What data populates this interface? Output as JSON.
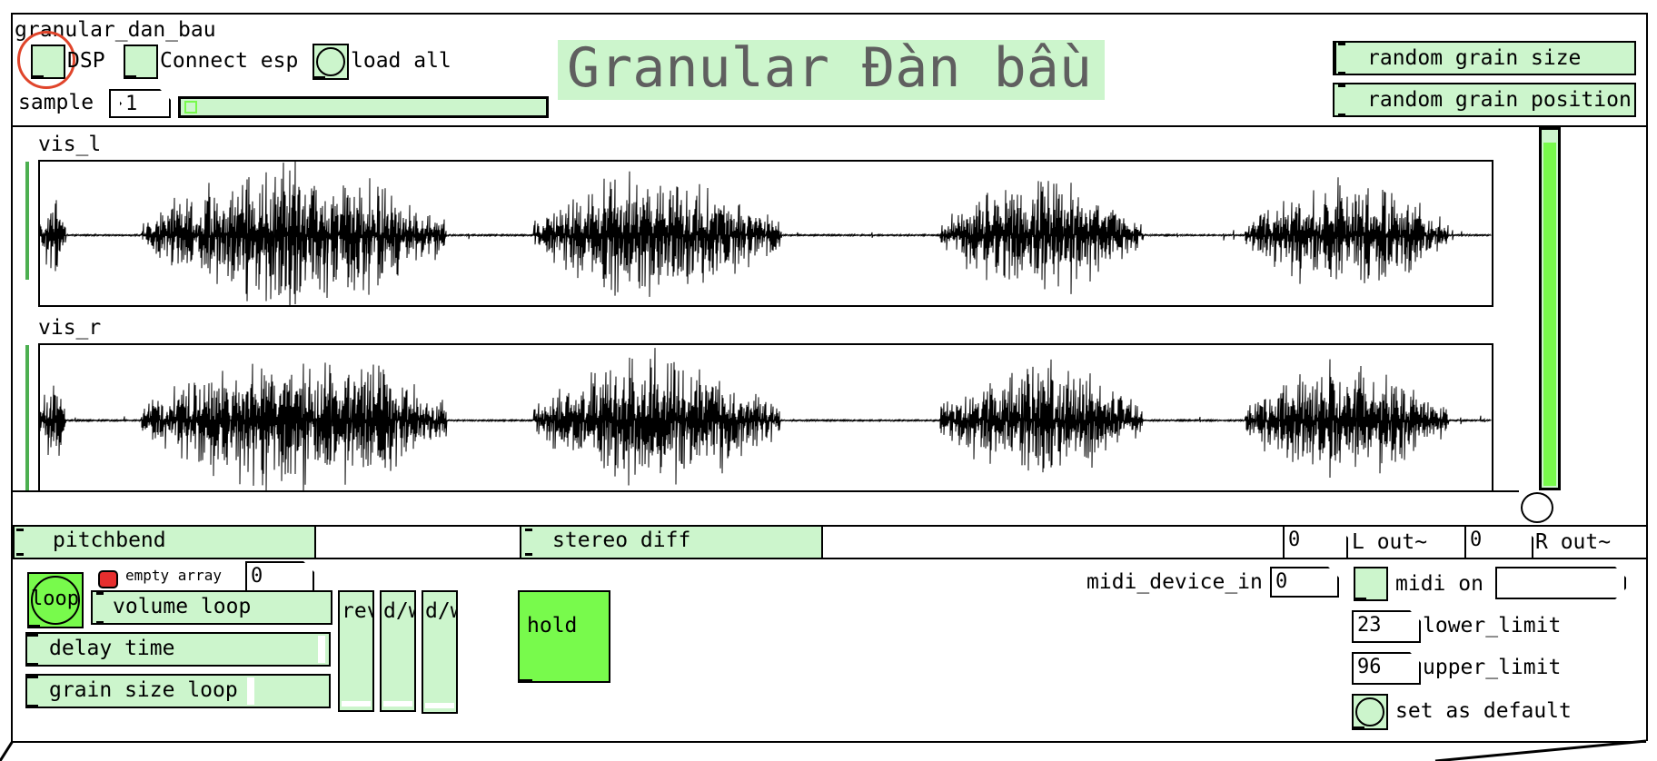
{
  "patch": {
    "title": "granular_dan_bau",
    "heading": "Granular Đàn bầu"
  },
  "header": {
    "dsp_label": "DSP",
    "connect_label": "Connect esp",
    "load_all_label": "load all",
    "sample_label": "sample",
    "sample_value": "1",
    "random_grain_size": "random grain size",
    "random_grain_position": "random grain position"
  },
  "arrays": {
    "left_name": "vis_l",
    "right_name": "vis_r"
  },
  "sliders": {
    "pitchbend": "pitchbend",
    "stereo_diff": "stereo diff",
    "volume_loop": "volume loop",
    "delay_time": "delay time",
    "grain_size_loop": "grain size loop",
    "rev": "rev",
    "dw1": "d/w",
    "dw2": "d/w",
    "master_level": 0.96
  },
  "outputs": {
    "l_value": "0",
    "l_label": "L out~",
    "r_value": "0",
    "r_label": "R out~"
  },
  "loop_section": {
    "loop_label": "loop",
    "empty_array_label": "empty array",
    "empty_array_value": "0",
    "hold_label": "hold"
  },
  "midi": {
    "device_label": "midi_device_in",
    "device_value": "0",
    "midi_on_label": "midi on",
    "lower_value": "23",
    "lower_label": "lower_limit",
    "upper_value": "96",
    "upper_label": "upper_limit",
    "default_label": "set as default"
  },
  "colors": {
    "pd_green": "#ccf5cc",
    "bright_green": "#78fa4c",
    "highlight_ring": "#e0452b",
    "red_bang": "#e62e2e"
  }
}
